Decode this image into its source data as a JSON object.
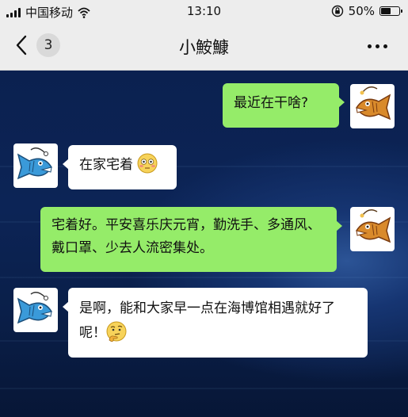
{
  "status_bar": {
    "carrier": "中国移动",
    "time": "13:10",
    "battery": "50%",
    "battery_level": 0.5
  },
  "nav": {
    "back_badge": "3",
    "title": "小鮟鱇",
    "icons": [
      "chevron-left-icon",
      "more-icon"
    ]
  },
  "messages": [
    {
      "from": "me",
      "text": "最近在干啥?"
    },
    {
      "from": "them",
      "text": "在家宅着",
      "emoji": "flushed-face-emoji"
    },
    {
      "from": "me",
      "text": "宅着好。平安喜乐庆元宵，勤洗手、多通风、戴口罩、少去人流密集处。"
    },
    {
      "from": "them",
      "text": "是啊，能和大家早一点在海博馆相遇就好了呢！",
      "emoji": "thinking-face-emoji"
    }
  ],
  "colors": {
    "my_bubble": "#95ec69",
    "their_bubble": "#ffffff",
    "bar_bg": "#ededed",
    "chat_bg": "#0b2150"
  }
}
